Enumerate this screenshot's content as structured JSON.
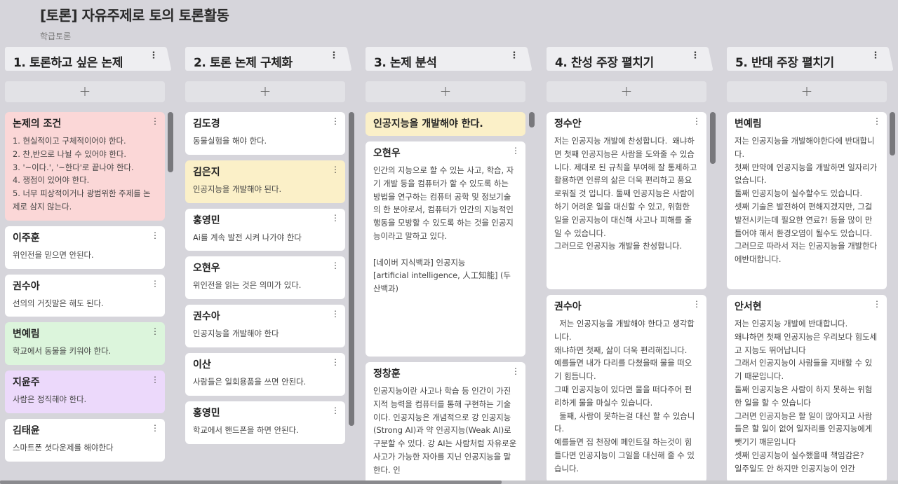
{
  "header": {
    "title": "[토론] 자유주제로 토의 토론활동",
    "subtitle": "학급토론"
  },
  "icons": {
    "menu": "kebab-menu-icon",
    "add": "plus-icon"
  },
  "add_label": "+",
  "kebab_label": "⋮",
  "columns": [
    {
      "title": "1. 토론하고 싶은 논제",
      "cards": [
        {
          "title": "논제의 조건",
          "body": "1. 현실적이고 구체적이어야 한다.\n2. 찬,반으로 나뉠 수 있어야 한다.\n3. '~이다.', '~한다'로 끝나야 한다.\n4. 쟁점이 있어야 한다.\n5. 너무 피상적이거나 광범위한 주제를 논제로 삼지 않는다.",
          "color": "#fbd7d7"
        },
        {
          "title": "이주훈",
          "body": "위인전을 믿으면 안된다.",
          "color": "#ffffff"
        },
        {
          "title": "권수아",
          "body": "선의의 거짓말은 해도 된다.",
          "color": "#ffffff"
        },
        {
          "title": "변예림",
          "body": "학교에서 동물을 키워야 한다.",
          "color": "#dcf5dc"
        },
        {
          "title": "지윤주",
          "body": "사람은 정직해야 한다.",
          "color": "#ecd9fb"
        },
        {
          "title": "김태윤",
          "body": "스마트폰 셧다운제를 해야한다",
          "color": "#ffffff"
        }
      ]
    },
    {
      "title": "2. 토론 논제 구체화",
      "cards": [
        {
          "title": "김도경",
          "body": "동물실험을 해야 한다.",
          "color": "#ffffff"
        },
        {
          "title": "김은지",
          "body": "인공지능을 개발해야 된다.",
          "color": "#fbf0c8"
        },
        {
          "title": "홍영민",
          "body": "Ai를 계속 발전 시켜 나가야 한다",
          "color": "#ffffff"
        },
        {
          "title": "오현우",
          "body": "위인전을 읽는 것은 의미가 있다.",
          "color": "#ffffff"
        },
        {
          "title": "권수아",
          "body": "인공지능을 개발해야 한다",
          "color": "#ffffff"
        },
        {
          "title": "이산",
          "body": "사람들은 일회용품을 쓰면 안된다.",
          "color": "#ffffff"
        },
        {
          "title": "홍영민",
          "body": "학교에서 핸드폰을 하면 안된다.",
          "color": "#ffffff"
        }
      ]
    },
    {
      "title": "3. 논제 분석",
      "cards": [
        {
          "title": "인공지능을 개발해야 한다.",
          "body": "",
          "color": "#fbf0c8"
        },
        {
          "title": "오현우",
          "body": "인간의 지능으로 할 수 있는 사고, 학습, 자기 개발 등을 컴퓨터가 할 수 있도록 하는 방법을 연구하는 컴퓨터 공학 및 정보기술의 한 분야로서, 컴퓨터가 인간의 지능적인 행동을 모방할 수 있도록 하는 것을 인공지능이라고 말하고 있다.\n\n[네이버 지식백과] 인공지능\n[artificial intelligence, 人工知能] (두산백과)",
          "color": "#ffffff"
        },
        {
          "title": "정창훈",
          "body": "인공지능이란 사고나 학습 등 인간이 가진 지적 능력을 컴퓨터를 통해 구현하는 기술이다. 인공지능은 개념적으로 강 인공지능(Strong AI)과 약 인공지능(Weak AI)로 구분할 수 있다. 강 AI는 사람처럼 자유로운 사고가 가능한 자아를 지닌 인공지능을 말한다. 인",
          "color": "#ffffff"
        }
      ]
    },
    {
      "title": "4. 찬성 주장 펼치기",
      "cards": [
        {
          "title": "정수안",
          "body": "저는 인공지능 개발에 찬성합니다.  왜냐하면 첫째 인공지능은 사람을 도와줄 수 있습니다. 제대로 된 규칙을 부여해 잘 통제하고 활용하면 인류의 삶은 더욱 편리하고 풍요로워질 것 입니다. 둘째 인공지능은 사람이 하기 어려운 일을 대신할 수 있고, 위험한 일을 인공지능이 대신해 사고나 피해를 줄일 수 있습니다.\n그러므로 인공지능 개발을 찬성합니다.",
          "color": "#ffffff"
        },
        {
          "title": "권수아",
          "body": "  저는 인공지능을 개발해야 한다고 생각합니다.\n왜냐하면 첫째, 삶이 더욱 편리해집니다.\n예를들면 내가 다리를 다쳤을때 물을 떠오기 힘듭니다.\n그때 인공지능이 있다면 물을 떠다주어 편리하게 물을 마실수 있습니다.\n  둘째, 사람이 못하는걸 대신 할 수 있습니다.\n예를들면 집 천장에 페인트질 하는것이 힘들다면 인공지능이 그일을 대신해 줄 수 있습니다.",
          "color": "#ffffff"
        }
      ]
    },
    {
      "title": "5. 반대 주장 펼치기",
      "cards": [
        {
          "title": "변예림",
          "body": "저는 인공지능을 개발해야한다에 반대합니다.\n첫째 만약에 인공지능을 개발하면 일자리가 없습니다.\n둘째 인공지능이 실수할수도 있습니다.\n셋째 기술은 발전하여 편해지겠지만, 그걸 발전시키는데 필요한 연료?! 등을 많이 만들어야 해서 환경오염이 될수도 있습니다. 그러므로 따라서 저는 인공지능을 개발한다에반대합니다.",
          "color": "#ffffff"
        },
        {
          "title": "안서현",
          "body": "저는 인공지능 개발에 반대합니다.\n왜냐하면 첫째 인공지능은 우리보다 힘도세고 지능도 뛰어납니다\n그래서 인공지능이 사람들을 지배할 수 있기 때문입니다.\n둘째 인공지능은 사람이 하지 못하는 위험한 일을 할 수 있습니다\n그러면 인공지능은 할 일이 많아지고 사람들은 할 일이 없어 일자리를 인공지능에게 뺏기기 깨문입니다\n셋째 인공지능이 실수했을때 책임감은?\n일주일도 안 하지만 인공지능이 인간",
          "color": "#ffffff"
        }
      ]
    }
  ]
}
